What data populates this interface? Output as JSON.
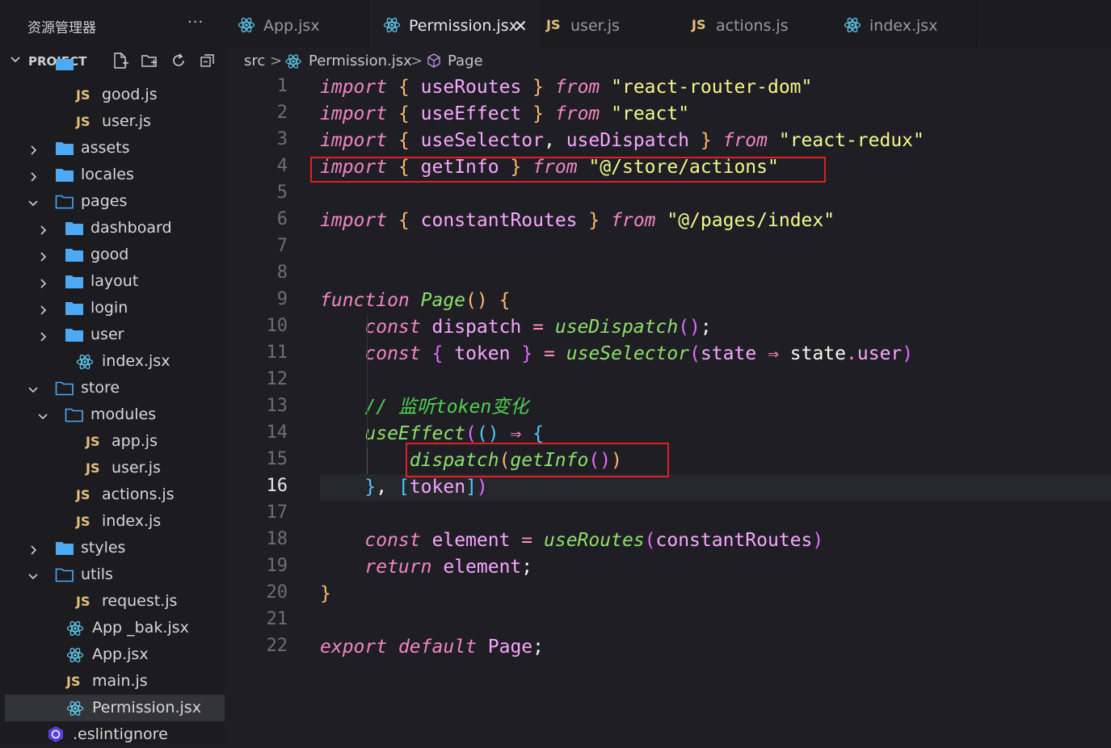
{
  "sidebar": {
    "title": "资源管理器",
    "more_label": "···",
    "project_label": "PROJECT",
    "items": [
      {
        "label": "good.js",
        "type": "js",
        "depth": 2
      },
      {
        "label": "user.js",
        "type": "js",
        "depth": 2
      },
      {
        "label": "assets",
        "type": "folder",
        "depth": 1,
        "expanded": false
      },
      {
        "label": "locales",
        "type": "folder",
        "depth": 1,
        "expanded": false
      },
      {
        "label": "pages",
        "type": "folder",
        "depth": 1,
        "expanded": true
      },
      {
        "label": "dashboard",
        "type": "folder",
        "depth": 2,
        "expanded": false
      },
      {
        "label": "good",
        "type": "folder",
        "depth": 2,
        "expanded": false
      },
      {
        "label": "layout",
        "type": "folder",
        "depth": 2,
        "expanded": false
      },
      {
        "label": "login",
        "type": "folder",
        "depth": 2,
        "expanded": false
      },
      {
        "label": "user",
        "type": "folder",
        "depth": 2,
        "expanded": false
      },
      {
        "label": "index.jsx",
        "type": "react",
        "depth": 2
      },
      {
        "label": "store",
        "type": "folder",
        "depth": 1,
        "expanded": true
      },
      {
        "label": "modules",
        "type": "folder",
        "depth": 2,
        "expanded": true
      },
      {
        "label": "app.js",
        "type": "js",
        "depth": 3
      },
      {
        "label": "user.js",
        "type": "js",
        "depth": 3
      },
      {
        "label": "actions.js",
        "type": "js",
        "depth": 2
      },
      {
        "label": "index.js",
        "type": "js",
        "depth": 2
      },
      {
        "label": "styles",
        "type": "folder",
        "depth": 1,
        "expanded": false
      },
      {
        "label": "utils",
        "type": "folder",
        "depth": 1,
        "expanded": true
      },
      {
        "label": "request.js",
        "type": "js",
        "depth": 2
      },
      {
        "label": "App _bak.jsx",
        "type": "react",
        "depth": 1
      },
      {
        "label": "App.jsx",
        "type": "react",
        "depth": 1
      },
      {
        "label": "main.js",
        "type": "js",
        "depth": 1
      },
      {
        "label": "Permission.jsx",
        "type": "react",
        "depth": 1,
        "selected": true
      },
      {
        "label": ".eslintignore",
        "type": "eslint",
        "depth": 0
      }
    ]
  },
  "tabs": [
    {
      "label": "App.jsx",
      "icon": "react-icon",
      "active": false
    },
    {
      "label": "Permission.jsx",
      "icon": "react-icon",
      "active": true
    },
    {
      "label": "user.js",
      "icon": "js-icon",
      "active": false
    },
    {
      "label": "actions.js",
      "icon": "js-icon",
      "active": false
    },
    {
      "label": "index.jsx",
      "icon": "react-icon",
      "active": false
    }
  ],
  "tab_close_glyph": "✕",
  "js_badge": "JS",
  "breadcrumb": {
    "root": "src",
    "file": "Permission.jsx",
    "symbol": "Page",
    "sep": ">"
  },
  "editor": {
    "current_line": 16,
    "line_numbers": [
      "1",
      "2",
      "3",
      "4",
      "5",
      "6",
      "7",
      "8",
      "9",
      "10",
      "11",
      "12",
      "13",
      "14",
      "15",
      "16",
      "17",
      "18",
      "19",
      "20",
      "21",
      "22"
    ],
    "lines": [
      [
        [
          "kw",
          "import"
        ],
        [
          "plain",
          " "
        ],
        [
          "br1",
          "{"
        ],
        [
          "plain",
          " "
        ],
        [
          "var",
          "useRoutes"
        ],
        [
          "plain",
          " "
        ],
        [
          "br1",
          "}"
        ],
        [
          "plain",
          " "
        ],
        [
          "kw",
          "from"
        ],
        [
          "plain",
          " "
        ],
        [
          "str",
          "\"react-router-dom\""
        ]
      ],
      [
        [
          "kw",
          "import"
        ],
        [
          "plain",
          " "
        ],
        [
          "br1",
          "{"
        ],
        [
          "plain",
          " "
        ],
        [
          "var",
          "useEffect"
        ],
        [
          "plain",
          " "
        ],
        [
          "br1",
          "}"
        ],
        [
          "plain",
          " "
        ],
        [
          "kw",
          "from"
        ],
        [
          "plain",
          " "
        ],
        [
          "str",
          "\"react\""
        ]
      ],
      [
        [
          "kw",
          "import"
        ],
        [
          "plain",
          " "
        ],
        [
          "br1",
          "{"
        ],
        [
          "plain",
          " "
        ],
        [
          "var",
          "useSelector"
        ],
        [
          "plain",
          ", "
        ],
        [
          "var",
          "useDispatch"
        ],
        [
          "plain",
          " "
        ],
        [
          "br1",
          "}"
        ],
        [
          "plain",
          " "
        ],
        [
          "kw",
          "from"
        ],
        [
          "plain",
          " "
        ],
        [
          "str",
          "\"react-redux\""
        ]
      ],
      [
        [
          "kw",
          "import"
        ],
        [
          "plain",
          " "
        ],
        [
          "br1",
          "{"
        ],
        [
          "plain",
          " "
        ],
        [
          "var",
          "getInfo"
        ],
        [
          "plain",
          " "
        ],
        [
          "br1",
          "}"
        ],
        [
          "plain",
          " "
        ],
        [
          "kw",
          "from"
        ],
        [
          "plain",
          " "
        ],
        [
          "str",
          "\"@/store/actions\""
        ]
      ],
      [],
      [
        [
          "kw",
          "import"
        ],
        [
          "plain",
          " "
        ],
        [
          "br1",
          "{"
        ],
        [
          "plain",
          " "
        ],
        [
          "var",
          "constantRoutes"
        ],
        [
          "plain",
          " "
        ],
        [
          "br1",
          "}"
        ],
        [
          "plain",
          " "
        ],
        [
          "kw",
          "from"
        ],
        [
          "plain",
          " "
        ],
        [
          "str",
          "\"@/pages/index\""
        ]
      ],
      [],
      [],
      [
        [
          "kw",
          "function"
        ],
        [
          "plain",
          " "
        ],
        [
          "fn",
          "Page"
        ],
        [
          "br1",
          "()"
        ],
        [
          "plain",
          " "
        ],
        [
          "br1",
          "{"
        ]
      ],
      [
        [
          "plain",
          "    "
        ],
        [
          "kw",
          "const"
        ],
        [
          "plain",
          " "
        ],
        [
          "var",
          "dispatch"
        ],
        [
          "plain",
          " "
        ],
        [
          "pun",
          "="
        ],
        [
          "plain",
          " "
        ],
        [
          "fn",
          "useDispatch"
        ],
        [
          "br2",
          "()"
        ],
        [
          "plain",
          ";"
        ]
      ],
      [
        [
          "plain",
          "    "
        ],
        [
          "kw",
          "const"
        ],
        [
          "plain",
          " "
        ],
        [
          "br2",
          "{"
        ],
        [
          "plain",
          " "
        ],
        [
          "var",
          "token"
        ],
        [
          "plain",
          " "
        ],
        [
          "br2",
          "}"
        ],
        [
          "plain",
          " "
        ],
        [
          "pun",
          "="
        ],
        [
          "plain",
          " "
        ],
        [
          "fn",
          "useSelector"
        ],
        [
          "br2",
          "("
        ],
        [
          "var",
          "state"
        ],
        [
          "plain",
          " "
        ],
        [
          "pun",
          "⇒"
        ],
        [
          "plain",
          " state"
        ],
        [
          "pun",
          "."
        ],
        [
          "var",
          "user"
        ],
        [
          "br2",
          ")"
        ]
      ],
      [],
      [
        [
          "plain",
          "    "
        ],
        [
          "cmt",
          "// 监听token变化"
        ]
      ],
      [
        [
          "plain",
          "    "
        ],
        [
          "fn",
          "useEffect"
        ],
        [
          "br2",
          "("
        ],
        [
          "br3",
          "()"
        ],
        [
          "plain",
          " "
        ],
        [
          "pun",
          "⇒"
        ],
        [
          "plain",
          " "
        ],
        [
          "br3",
          "{"
        ]
      ],
      [
        [
          "plain",
          "        "
        ],
        [
          "fn",
          "dispatch"
        ],
        [
          "br1",
          "("
        ],
        [
          "fn",
          "getInfo"
        ],
        [
          "br2",
          "()"
        ],
        [
          "br1",
          ")"
        ]
      ],
      [
        [
          "plain",
          "    "
        ],
        [
          "br3",
          "}"
        ],
        [
          "plain",
          ", "
        ],
        [
          "br3",
          "["
        ],
        [
          "var",
          "token"
        ],
        [
          "br3",
          "]"
        ],
        [
          "br2",
          ")"
        ]
      ],
      [],
      [
        [
          "plain",
          "    "
        ],
        [
          "kw",
          "const"
        ],
        [
          "plain",
          " "
        ],
        [
          "var",
          "element"
        ],
        [
          "plain",
          " "
        ],
        [
          "pun",
          "="
        ],
        [
          "plain",
          " "
        ],
        [
          "fn",
          "useRoutes"
        ],
        [
          "br2",
          "("
        ],
        [
          "var",
          "constantRoutes"
        ],
        [
          "br2",
          ")"
        ]
      ],
      [
        [
          "plain",
          "    "
        ],
        [
          "kw",
          "return"
        ],
        [
          "plain",
          " "
        ],
        [
          "var",
          "element"
        ],
        [
          "plain",
          ";"
        ]
      ],
      [
        [
          "br1",
          "}"
        ]
      ],
      [],
      [
        [
          "kw",
          "export"
        ],
        [
          "plain",
          " "
        ],
        [
          "kw",
          "default"
        ],
        [
          "plain",
          " "
        ],
        [
          "var",
          "Page"
        ],
        [
          "plain",
          ";"
        ]
      ]
    ]
  }
}
